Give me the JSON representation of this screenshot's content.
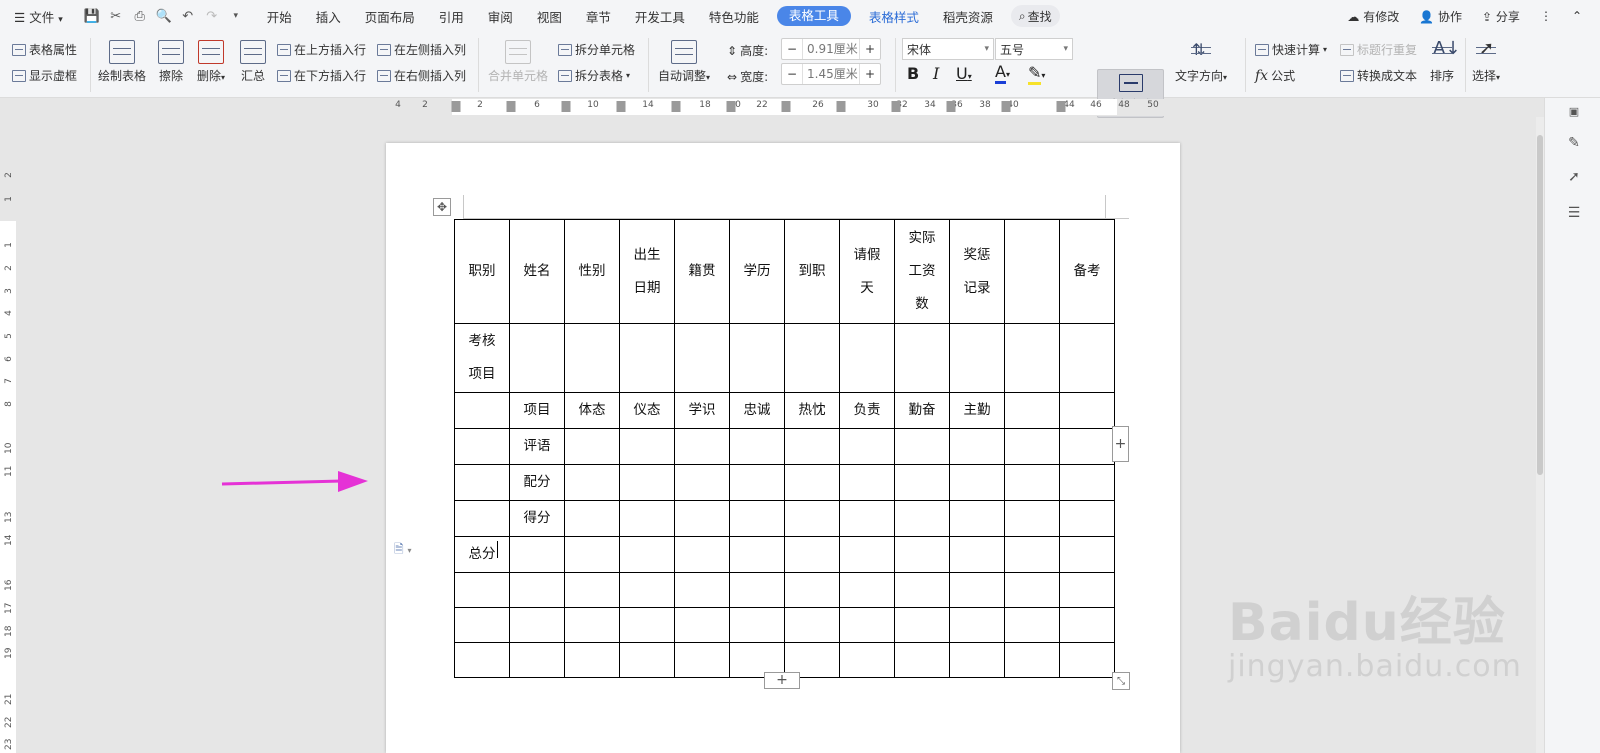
{
  "menubar": {
    "file": "文件",
    "tabs": [
      "开始",
      "插入",
      "页面布局",
      "引用",
      "审阅",
      "视图",
      "章节",
      "开发工具",
      "特色功能"
    ],
    "tool_tab": "表格工具",
    "style_tab": "表格样式",
    "resource_tab": "稻壳资源",
    "search": "查找",
    "right": [
      "有修改",
      "协作",
      "分享"
    ]
  },
  "ribbon": {
    "table_props": "表格属性",
    "show_grid": "显示虚框",
    "draw_table": "绘制表格",
    "erase": "擦除",
    "delete": "删除",
    "summary": "汇总",
    "insert_above": "在上方插入行",
    "insert_below": "在下方插入行",
    "insert_left": "在左侧插入列",
    "insert_right": "在右侧插入列",
    "merge_cells": "合并单元格",
    "split_cells": "拆分单元格",
    "split_table": "拆分表格",
    "auto_fit": "自动调整",
    "height_label": "高度:",
    "height_value": "0.91厘米",
    "width_label": "宽度:",
    "width_value": "1.45厘米",
    "font_name": "宋体",
    "font_size": "五号",
    "bold": "B",
    "italic": "I",
    "underline": "U",
    "font_color": "A",
    "align": "对齐方式",
    "text_dir": "文字方向",
    "quick_calc": "快速计算",
    "repeat_header": "标题行重复",
    "formula": "公式",
    "to_text": "转换成文本",
    "sort": "排序",
    "select": "选择"
  },
  "ruler": {
    "h_ticks": [
      "4",
      "2",
      "2",
      "6",
      "10",
      "14",
      "18",
      "0",
      "22",
      "26",
      "30",
      "32",
      "34",
      "36",
      "38",
      "40",
      "44",
      "46",
      "48",
      "50"
    ],
    "v_ticks": [
      "2",
      "1",
      "1",
      "2",
      "3",
      "4",
      "5",
      "6",
      "7",
      "8",
      "10",
      "11",
      "13",
      "14",
      "16",
      "17",
      "18",
      "19",
      "21",
      "22",
      "23"
    ]
  },
  "table": {
    "header": [
      "职别",
      "姓名",
      "性别",
      "出生\n日期",
      "籍贯",
      "学历",
      "到职",
      "请假\n天",
      "实际\n工资\n数",
      "奖惩\n记录",
      "",
      "备考"
    ],
    "row_kaohe": "考核\n项目",
    "row_items": [
      "",
      "项目",
      "体态",
      "仪态",
      "学识",
      "忠诚",
      "热忱",
      "负责",
      "勤奋",
      "主勤",
      "",
      ""
    ],
    "row_pingyu": "评语",
    "row_peifen": "配分",
    "row_defen": "得分",
    "row_total": "总分"
  },
  "colors": {
    "accent": "#4a86e8",
    "arrow": "#e532d6",
    "font_color_bar": "#1a3fd6",
    "highlight_bar": "#f7e22a"
  },
  "watermark": {
    "main": "Baidu经验",
    "sub": "jingyan.baidu.com"
  }
}
